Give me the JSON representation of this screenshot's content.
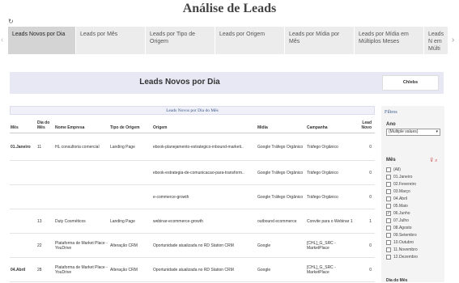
{
  "title": "Análise de Leads",
  "tabs": [
    {
      "label": "Leads Novos por Dia",
      "active": true
    },
    {
      "label": "Leads por Mês",
      "active": false
    },
    {
      "label": "Leads por Tipo de Origem",
      "active": false
    },
    {
      "label": "Leads por Origem",
      "active": false
    },
    {
      "label": "Leads por Mídia por Mês",
      "active": false
    },
    {
      "label": "Leads por Mídia em Múltiplos Meses",
      "active": false
    },
    {
      "label": "Leads N em Múlti",
      "active": false
    }
  ],
  "banner": {
    "title": "Leads Novos por Dia",
    "box_label": "Chlebs"
  },
  "table": {
    "caption": "Leads Novos por Dia do Mês",
    "headers": {
      "mes": "Mês",
      "dia": "Dia do Mês",
      "empresa": "Nome Empresa",
      "tipo": "Tipo de Origem",
      "origem": "Origem",
      "midia": "Mídia",
      "campanha": "Campanha",
      "lead": "Lead Novo"
    },
    "rows": [
      {
        "mes": "01.Janeiro",
        "dia": "11",
        "empresa": "HL consultoria comercial",
        "tipo": "Landing Page",
        "origem": "ebook-planejamento-estrategico-inbound-marketi..",
        "midia": "Google Tráfego Orgânico",
        "campanha": "Tráfego Orgânico",
        "lead": "0"
      },
      {
        "mes": "",
        "dia": "",
        "empresa": "",
        "tipo": "",
        "origem": "ebook-estrategia-de-comunicacao-para-transform..",
        "midia": "Google Tráfego Orgânico",
        "campanha": "Tráfego Orgânico",
        "lead": "0"
      },
      {
        "mes": "",
        "dia": "",
        "empresa": "",
        "tipo": "",
        "origem": "e-commerce-growth",
        "midia": "Google Tráfego Orgânico",
        "campanha": "Tráfego Orgânico",
        "lead": "0"
      },
      {
        "mes": "",
        "dia": "13",
        "empresa": "Duty Cosméticos",
        "tipo": "Landing Page",
        "origem": "webinar-ecommerce-growth",
        "midia": "outbound ecommerce",
        "campanha": "Convite para o Webinar 1",
        "lead": "1"
      },
      {
        "mes": "",
        "dia": "22",
        "empresa": "Plataforma de Market Place - YouDrive",
        "tipo": "Alteração CRM",
        "origem": "Oportunidade atualizada no RD Station CRM",
        "midia": "Google",
        "campanha": "[CHL]_G_SRC - MarketPlace",
        "lead": "0"
      },
      {
        "mes": "04.Abril",
        "dia": "28",
        "empresa": "Plataforma de Market Place - YouDrive",
        "tipo": "Alteração CRM",
        "origem": "Oportunidade atualizada no RD Station CRM",
        "midia": "Google",
        "campanha": "[CHL]_G_SRC - MarketPlace",
        "lead": "0"
      }
    ]
  },
  "filters": {
    "title": "Filtros",
    "ano": {
      "label": "Ano",
      "value": "(Multiple values)"
    },
    "mes": {
      "label": "Mês",
      "options": [
        {
          "label": "(All)",
          "checked": false
        },
        {
          "label": "01.Janeiro",
          "checked": false
        },
        {
          "label": "02.Fevereiro",
          "checked": false
        },
        {
          "label": "03.Março",
          "checked": false
        },
        {
          "label": "04.Abril",
          "checked": false
        },
        {
          "label": "05.Maio",
          "checked": false
        },
        {
          "label": "06.Junho",
          "checked": true
        },
        {
          "label": "07.Julho",
          "checked": false
        },
        {
          "label": "08.Agosto",
          "checked": false
        },
        {
          "label": "09.Setembro",
          "checked": false
        },
        {
          "label": "10.Outubro",
          "checked": false
        },
        {
          "label": "11.Novembro",
          "checked": false
        },
        {
          "label": "12.Dezembro",
          "checked": false
        }
      ]
    },
    "next_label": "Dia do Mês"
  }
}
